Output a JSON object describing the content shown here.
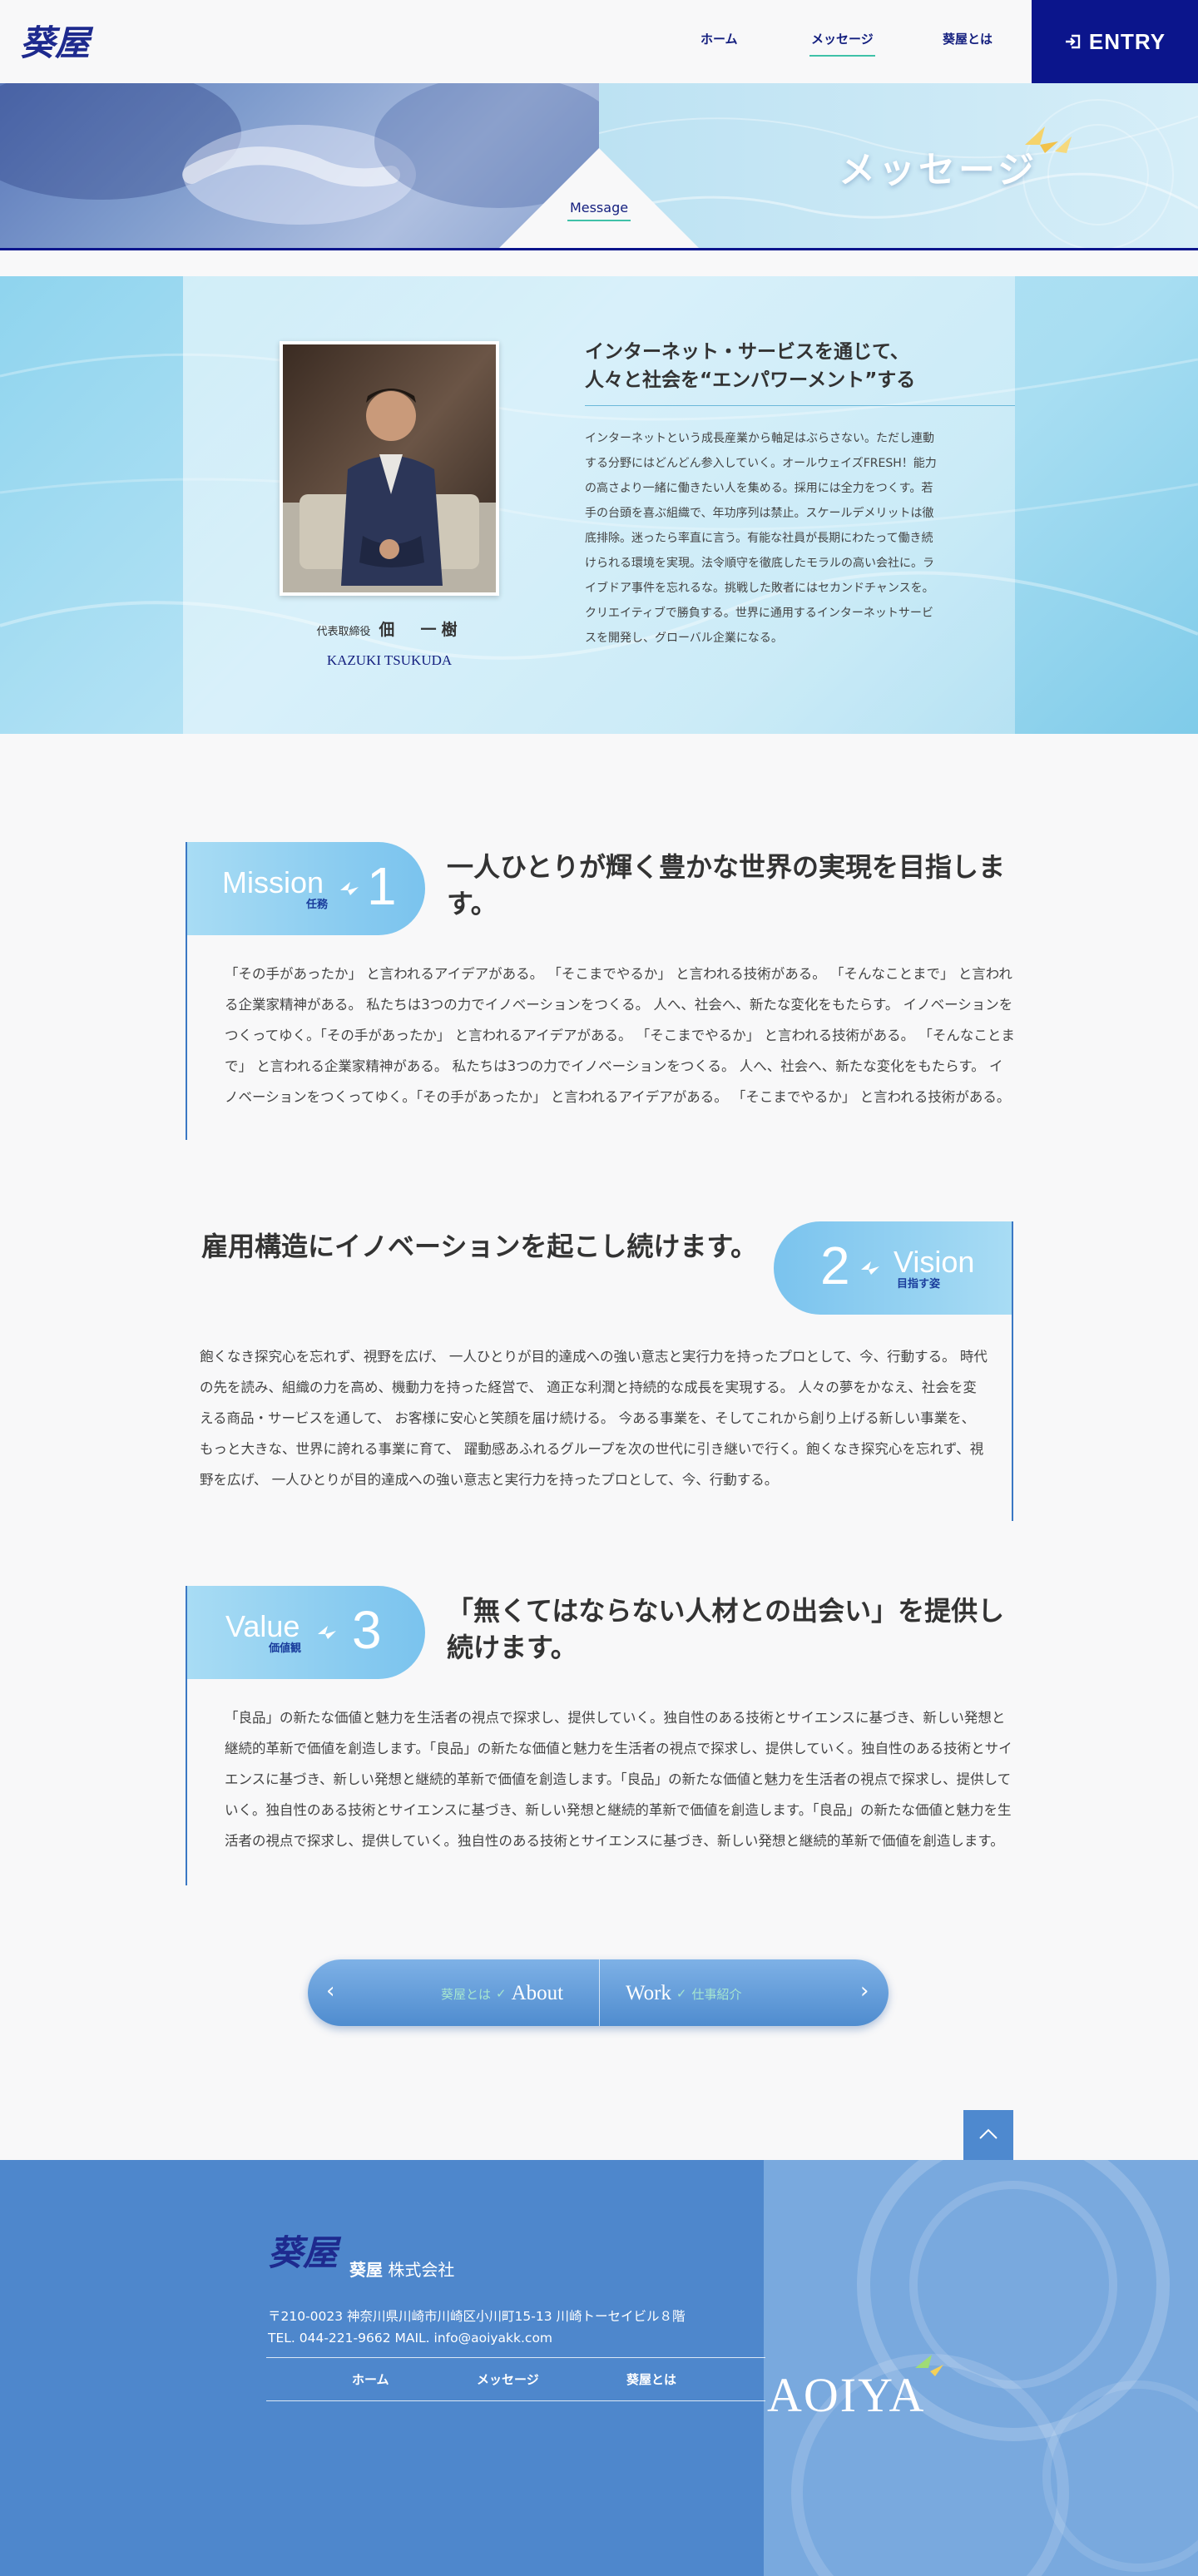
{
  "header": {
    "logo_text": "葵屋",
    "nav": [
      {
        "label": "ホーム"
      },
      {
        "label": "メッセージ"
      },
      {
        "label": "葵屋とは"
      }
    ],
    "entry_label": "ENTRY"
  },
  "hero": {
    "title": "メッセージ",
    "tab_label": "Message"
  },
  "ceo": {
    "role": "代表取締役",
    "name": "佃　一樹",
    "name_en": "KAZUKI TSUKUDA",
    "headline_1": "インターネット・サービスを通じて、",
    "headline_2": "人々と社会を“エンパワーメント”する",
    "body": "インターネットという成長産業から軸足はぶらさない。ただし連動する分野にはどんどん参入していく。オールウェイズFRESH！能力の高さより一緒に働きたい人を集める。採用には全力をつくす。若手の台頭を喜ぶ組織で、年功序列は禁止。スケールデメリットは徹底排除。迷ったら率直に言う。有能な社員が長期にわたって働き続けられる環境を実現。法令順守を徹底したモラルの高い会社に。ライブドア事件を忘れるな。挑戦した敗者にはセカンドチャンスを。クリエイティブで勝負する。世界に通用するインターネットサービスを開発し、グローバル企業になる。"
  },
  "mission": {
    "word": "Mission",
    "sub": "任務",
    "num": "1",
    "title": "一人ひとりが輝く豊かな世界の実現を目指します。",
    "body": "「その手があったか」 と言われるアイデアがある。 「そこまでやるか」 と言われる技術がある。 「そんなことまで」 と言われる企業家精神がある。 私たちは3つの力でイノベーションをつくる。 人へ、社会へ、新たな変化をもたらす。 イノベーションをつくってゆく。「その手があったか」 と言われるアイデアがある。 「そこまでやるか」 と言われる技術がある。 「そんなことまで」 と言われる企業家精神がある。 私たちは3つの力でイノベーションをつくる。 人へ、社会へ、新たな変化をもたらす。 イノベーションをつくってゆく。「その手があったか」 と言われるアイデアがある。 「そこまでやるか」 と言われる技術がある。"
  },
  "vision": {
    "word": "Vision",
    "sub": "目指す姿",
    "num": "2",
    "title": "雇用構造にイノベーションを起こし続けます。",
    "body": "飽くなき探究心を忘れず、視野を広げ、 一人ひとりが目的達成への強い意志と実行力を持ったプロとして、今、行動する。 時代の先を読み、組織の力を高め、機動力を持った経営で、 適正な利潤と持続的な成長を実現する。 人々の夢をかなえ、社会を変える商品・サービスを通して、 お客様に安心と笑顔を届け続ける。 今ある事業を、そしてこれから創り上げる新しい事業を、 もっと大きな、世界に誇れる事業に育て、 躍動感あふれるグループを次の世代に引き継いで行く。飽くなき探究心を忘れず、視野を広げ、 一人ひとりが目的達成への強い意志と実行力を持ったプロとして、今、行動する。"
  },
  "value": {
    "word": "Value",
    "sub": "価値観",
    "num": "3",
    "title": "「無くてはならない人材との出会い」を提供し続けます。",
    "body": "「良品」の新たな価値と魅力を生活者の視点で探求し、提供していく。独自性のある技術とサイエンスに基づき、新しい発想と継続的革新で価値を創造します。「良品」の新たな価値と魅力を生活者の視点で探求し、提供していく。独自性のある技術とサイエンスに基づき、新しい発想と継続的革新で価値を創造します。「良品」の新たな価値と魅力を生活者の視点で探求し、提供していく。独自性のある技術とサイエンスに基づき、新しい発想と継続的革新で価値を創造します。「良品」の新たな価値と魅力を生活者の視点で探求し、提供していく。独自性のある技術とサイエンスに基づき、新しい発想と継続的革新で価値を創造します。"
  },
  "pager": {
    "prev_jp": "葵屋とは",
    "prev_en": "About",
    "next_en": "Work",
    "next_jp": "仕事紹介"
  },
  "footer": {
    "company": "葵屋",
    "company_suffix": "株式会社",
    "address": "〒210-0023 神奈川県川崎市川崎区小川町15-13 川崎トーセイビル８階",
    "contact": "TEL. 044-221-9662 MAIL. info@aoiyakk.com",
    "nav": [
      {
        "label": "ホーム"
      },
      {
        "label": "メッセージ"
      },
      {
        "label": "葵屋とは"
      }
    ],
    "brand_mark": "AOIYA"
  },
  "colors": {
    "navy": "#0b158c",
    "accent_green": "#3fc1a8",
    "footer_blue": "#4e87cc",
    "pill_light": "#bfe6f6",
    "pill_blue": "#79c2ee"
  }
}
